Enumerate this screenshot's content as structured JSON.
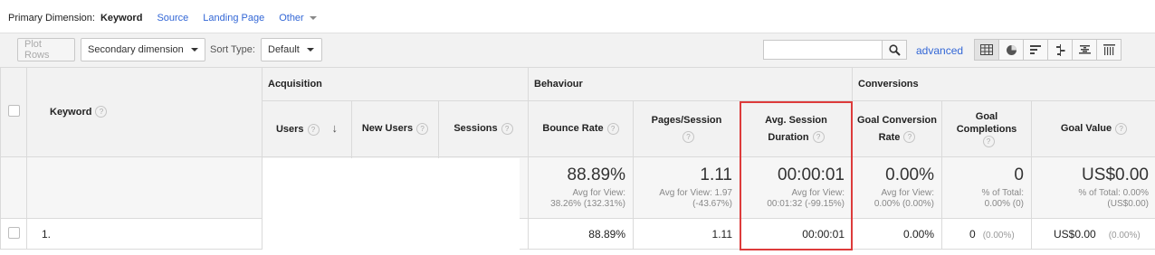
{
  "primary_dimension": {
    "label": "Primary Dimension:",
    "active": "Keyword",
    "links": [
      "Source",
      "Landing Page"
    ],
    "other": "Other"
  },
  "toolbar": {
    "plot_rows": "Plot Rows",
    "secondary_dimension": "Secondary dimension",
    "sort_type_label": "Sort Type:",
    "sort_type_value": "Default",
    "search_value": "",
    "advanced": "advanced"
  },
  "groups": {
    "acquisition": "Acquisition",
    "behaviour": "Behaviour",
    "conversions": "Conversions"
  },
  "columns": {
    "keyword": "Keyword",
    "users": "Users",
    "new_users": "New Users",
    "sessions": "Sessions",
    "bounce_rate": "Bounce Rate",
    "pages_session": "Pages/Session",
    "avg_session_1": "Avg. Session",
    "avg_session_2": "Duration",
    "goal_conv_1": "Goal Conversion",
    "goal_conv_2": "Rate",
    "goal_comp_1": "Goal",
    "goal_comp_2": "Completions",
    "goal_value": "Goal Value"
  },
  "totals": {
    "bounce_rate": {
      "value": "88.89%",
      "sub1": "Avg for View:",
      "sub2": "38.26% (132.31%)"
    },
    "pages_session": {
      "value": "1.11",
      "sub1": "Avg for View: 1.97",
      "sub2": "(-43.67%)"
    },
    "avg_session": {
      "value": "00:00:01",
      "sub1": "Avg for View:",
      "sub2": "00:01:32 (-99.15%)"
    },
    "goal_conv": {
      "value": "0.00%",
      "sub1": "Avg for View:",
      "sub2": "0.00% (0.00%)"
    },
    "goal_comp": {
      "value": "0",
      "sub1": "% of Total:",
      "sub2": "0.00% (0)"
    },
    "goal_value": {
      "value": "US$0.00",
      "sub1": "% of Total: 0.00%",
      "sub2": "(US$0.00)"
    }
  },
  "rows": [
    {
      "index": "1.",
      "bounce_rate": "88.89%",
      "pages_session": "1.11",
      "avg_session": "00:00:01",
      "goal_conv": "0.00%",
      "goal_comp": "0",
      "goal_comp_pct": "(0.00%)",
      "goal_value": "US$0.00",
      "goal_value_pct": "(0.00%)"
    }
  ],
  "colors": {
    "link": "#3367d6",
    "highlight": "#dd3b3b",
    "header_bg": "#f2f2f2"
  }
}
